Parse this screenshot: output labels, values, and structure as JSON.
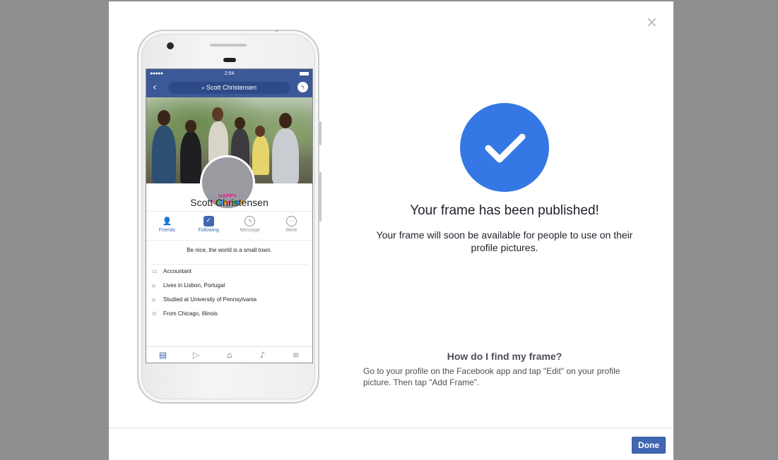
{
  "modal": {
    "close_label": "×",
    "done_label": "Done"
  },
  "phone": {
    "status": {
      "signal": "●●●●● ",
      "time": "2:04"
    },
    "search": {
      "text": "Scott Christensen",
      "icon": "search-icon"
    },
    "profile": {
      "frame_text": "HAPPY BIRTHDAY",
      "name": "Scott Christensen",
      "actions": [
        {
          "label": "Friends",
          "icon": "friends-icon",
          "active": true
        },
        {
          "label": "Following",
          "icon": "following-icon",
          "active": true
        },
        {
          "label": "Message",
          "icon": "messenger-icon",
          "active": false
        },
        {
          "label": "More",
          "icon": "more-icon",
          "active": false
        }
      ],
      "bio": "Be nice, the world is a small town.",
      "info": [
        {
          "icon": "briefcase-icon",
          "text": "Accountant"
        },
        {
          "icon": "home-icon",
          "text": "Lives in Lisbon, Portugal"
        },
        {
          "icon": "graduation-cap-icon",
          "text": "Studied at University of Pennsylvania"
        },
        {
          "icon": "location-pin-icon",
          "text": "From Chicago, Illinois"
        }
      ],
      "tabs": [
        "news-feed-icon",
        "watch-icon",
        "marketplace-icon",
        "notifications-icon",
        "menu-icon"
      ]
    }
  },
  "success": {
    "title": "Your frame has been published!",
    "message": "Your frame will soon be available for people to use on their profile pictures.",
    "help_title": "How do I find my frame?",
    "help_text": "Go to your profile on the Facebook app and tap \"Edit\" on your profile picture. Then tap \"Add Frame\"."
  },
  "colors": {
    "overlay": "#8e8f90",
    "accent_blue": "#3578e5",
    "button_blue": "#4267b2",
    "facebook_blue": "#3b5998"
  }
}
